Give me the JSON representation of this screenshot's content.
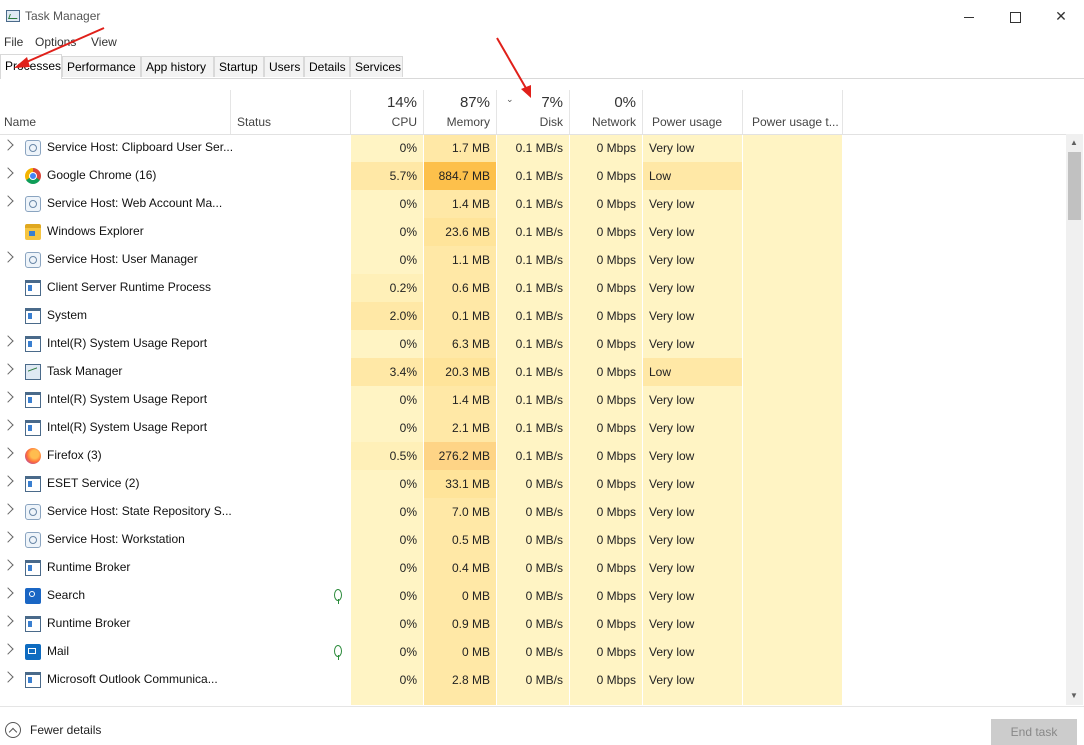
{
  "window": {
    "title": "Task Manager",
    "minimize_icon": "minimize-icon",
    "maximize_icon": "maximize-icon",
    "close_icon": "close-icon",
    "close_glyph": "✕"
  },
  "menu": [
    "File",
    "Options",
    "View"
  ],
  "tabs": [
    "Processes",
    "Performance",
    "App history",
    "Startup",
    "Users",
    "Details",
    "Services"
  ],
  "active_tab": "Processes",
  "columns": {
    "name": "Name",
    "status": "Status",
    "cpu_pct": "14%",
    "cpu": "CPU",
    "memory_pct": "87%",
    "memory": "Memory",
    "disk_pct": "7%",
    "disk": "Disk",
    "network_pct": "0%",
    "network": "Network",
    "power": "Power usage",
    "power_trend": "Power usage t...",
    "sort_glyph": "⌄"
  },
  "processes": [
    {
      "name": "Service Host: Clipboard User Ser...",
      "icon": "gear-icon",
      "cpu": "0%",
      "memory": "1.7 MB",
      "disk": "0.1 MB/s",
      "network": "0 Mbps",
      "power": "Very low"
    },
    {
      "name": "Google Chrome (16)",
      "icon": "chrome-icon",
      "cpu": "5.7%",
      "memory": "884.7 MB",
      "disk": "0.1 MB/s",
      "network": "0 Mbps",
      "power": "Low"
    },
    {
      "name": "Service Host: Web Account Ma...",
      "icon": "gear-icon",
      "cpu": "0%",
      "memory": "1.4 MB",
      "disk": "0.1 MB/s",
      "network": "0 Mbps",
      "power": "Very low"
    },
    {
      "name": "Windows Explorer",
      "icon": "folder-icon",
      "cpu": "0%",
      "memory": "23.6 MB",
      "disk": "0.1 MB/s",
      "network": "0 Mbps",
      "power": "Very low"
    },
    {
      "name": "Service Host: User Manager",
      "icon": "gear-icon",
      "cpu": "0%",
      "memory": "1.1 MB",
      "disk": "0.1 MB/s",
      "network": "0 Mbps",
      "power": "Very low"
    },
    {
      "name": "Client Server Runtime Process",
      "icon": "window-icon",
      "cpu": "0.2%",
      "memory": "0.6 MB",
      "disk": "0.1 MB/s",
      "network": "0 Mbps",
      "power": "Very low"
    },
    {
      "name": "System",
      "icon": "window-icon",
      "cpu": "2.0%",
      "memory": "0.1 MB",
      "disk": "0.1 MB/s",
      "network": "0 Mbps",
      "power": "Very low"
    },
    {
      "name": "Intel(R) System Usage Report",
      "icon": "window-icon",
      "cpu": "0%",
      "memory": "6.3 MB",
      "disk": "0.1 MB/s",
      "network": "0 Mbps",
      "power": "Very low"
    },
    {
      "name": "Task Manager",
      "icon": "task-manager-icon",
      "cpu": "3.4%",
      "memory": "20.3 MB",
      "disk": "0.1 MB/s",
      "network": "0 Mbps",
      "power": "Low"
    },
    {
      "name": "Intel(R) System Usage Report",
      "icon": "window-icon",
      "cpu": "0%",
      "memory": "1.4 MB",
      "disk": "0.1 MB/s",
      "network": "0 Mbps",
      "power": "Very low"
    },
    {
      "name": "Intel(R) System Usage Report",
      "icon": "window-icon",
      "cpu": "0%",
      "memory": "2.1 MB",
      "disk": "0.1 MB/s",
      "network": "0 Mbps",
      "power": "Very low"
    },
    {
      "name": "Firefox (3)",
      "icon": "firefox-icon",
      "cpu": "0.5%",
      "memory": "276.2 MB",
      "disk": "0.1 MB/s",
      "network": "0 Mbps",
      "power": "Very low"
    },
    {
      "name": "ESET Service (2)",
      "icon": "window-icon",
      "cpu": "0%",
      "memory": "33.1 MB",
      "disk": "0 MB/s",
      "network": "0 Mbps",
      "power": "Very low"
    },
    {
      "name": "Service Host: State Repository S...",
      "icon": "gear-icon",
      "cpu": "0%",
      "memory": "7.0 MB",
      "disk": "0 MB/s",
      "network": "0 Mbps",
      "power": "Very low"
    },
    {
      "name": "Service Host: Workstation",
      "icon": "gear-icon",
      "cpu": "0%",
      "memory": "0.5 MB",
      "disk": "0 MB/s",
      "network": "0 Mbps",
      "power": "Very low"
    },
    {
      "name": "Runtime Broker",
      "icon": "window-icon",
      "cpu": "0%",
      "memory": "0.4 MB",
      "disk": "0 MB/s",
      "network": "0 Mbps",
      "power": "Very low"
    },
    {
      "name": "Search",
      "icon": "search-icon",
      "cpu": "0%",
      "memory": "0 MB",
      "disk": "0 MB/s",
      "network": "0 Mbps",
      "power": "Very low",
      "suspended": true
    },
    {
      "name": "Runtime Broker",
      "icon": "window-icon",
      "cpu": "0%",
      "memory": "0.9 MB",
      "disk": "0 MB/s",
      "network": "0 Mbps",
      "power": "Very low"
    },
    {
      "name": "Mail",
      "icon": "mail-icon",
      "cpu": "0%",
      "memory": "0 MB",
      "disk": "0 MB/s",
      "network": "0 Mbps",
      "power": "Very low",
      "suspended": true
    },
    {
      "name": "Microsoft Outlook Communica...",
      "icon": "window-icon",
      "cpu": "0%",
      "memory": "2.8 MB",
      "disk": "0 MB/s",
      "network": "0 Mbps",
      "power": "Very low"
    }
  ],
  "footer": {
    "fewer_details": "Fewer details",
    "end_task": "End task"
  },
  "colors": {
    "heat_light": "#fff4c4",
    "heat_medium": "#ffe8a6",
    "heat_strong": "#fdc04b",
    "annotation_arrow": "#e0201a"
  }
}
